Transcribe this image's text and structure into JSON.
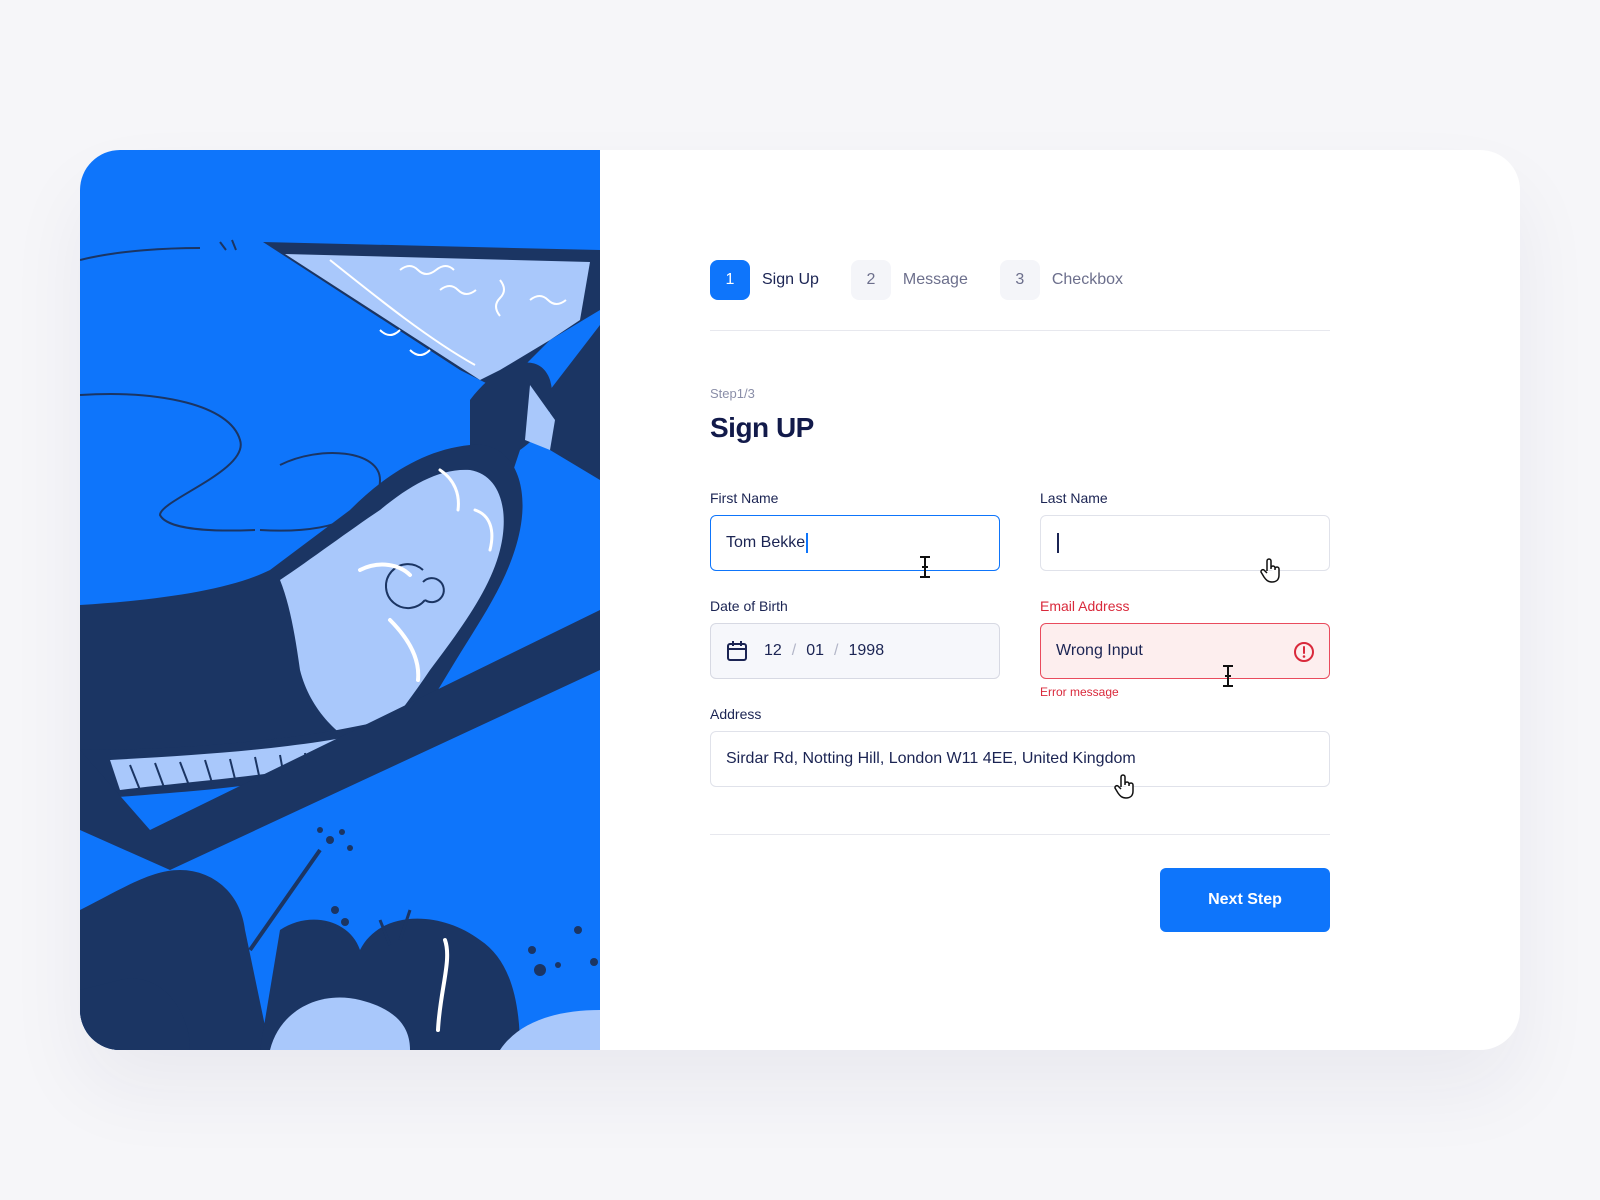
{
  "stepper": {
    "steps": [
      {
        "number": "1",
        "label": "Sign Up",
        "active": true
      },
      {
        "number": "2",
        "label": "Message",
        "active": false
      },
      {
        "number": "3",
        "label": "Checkbox",
        "active": false
      }
    ]
  },
  "form": {
    "step_count": "Step1/3",
    "title": "Sign UP",
    "first_name": {
      "label": "First Name",
      "value": "Tom Bekke"
    },
    "last_name": {
      "label": "Last Name",
      "value": ""
    },
    "dob": {
      "label": "Date of Birth",
      "day": "12",
      "month": "01",
      "year": "1998",
      "separator": "/"
    },
    "email": {
      "label": "Email Address",
      "value": "Wrong Input",
      "error": "Error message"
    },
    "address": {
      "label": "Address",
      "value": "Sirdar Rd, Notting Hill, London W11 4EE, United Kingdom"
    },
    "next_label": "Next Step"
  },
  "icons": {
    "calendar": "calendar-icon",
    "alert": "alert-circle-icon",
    "text_cursor": "text-cursor-icon",
    "hand_cursor": "hand-pointer-icon"
  },
  "colors": {
    "accent": "#0e75fb",
    "error": "#d9293b",
    "error_bg": "#fdeeee",
    "title": "#121a4a",
    "illustration_dark": "#1b3563",
    "illustration_light": "#a9c8fb"
  }
}
